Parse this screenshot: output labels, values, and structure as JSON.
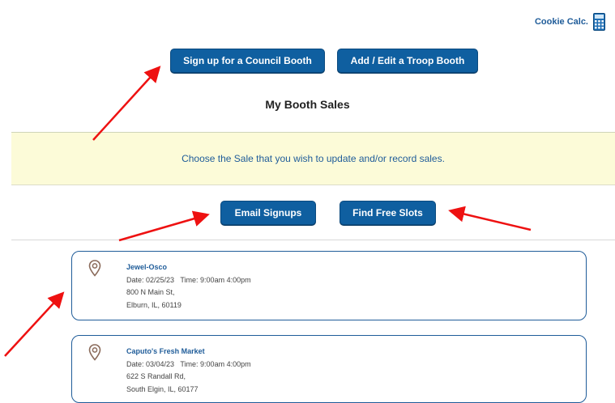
{
  "header": {
    "cookie_calc_label": "Cookie Calc.",
    "icon": "calculator-icon"
  },
  "top_buttons": {
    "council_booth": "Sign up for a Council Booth",
    "troop_booth": "Add / Edit a Troop Booth"
  },
  "page_title": "My Booth Sales",
  "banner_text": "Choose the Sale that you wish to update and/or record sales.",
  "action_buttons": {
    "email_signups": "Email Signups",
    "find_free_slots": "Find Free Slots"
  },
  "booths": [
    {
      "name": "Jewel-Osco",
      "date_line": "Date: 02/25/23   Time: 9:00am 4:00pm",
      "address": "800 N Main St,",
      "city": "Elburn, IL, 60119",
      "icon": "location-pin-icon"
    },
    {
      "name": "Caputo's Fresh Market",
      "date_line": "Date: 03/04/23   Time: 9:00am 4:00pm",
      "address": "622 S Randall Rd,",
      "city": "South Elgin, IL, 60177",
      "icon": "location-pin-icon"
    }
  ],
  "colors": {
    "primary": "#0f5fa0",
    "link": "#1f5c99",
    "banner": "#fcfbd8",
    "arrow": "#ee1111",
    "pin": "#8a6a5a"
  }
}
